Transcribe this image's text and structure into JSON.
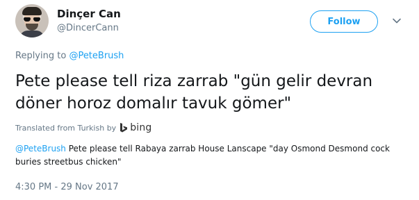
{
  "author": {
    "name": "Dinçer Can",
    "handle": "@DincerCann"
  },
  "actions": {
    "follow_label": "Follow"
  },
  "reply": {
    "prefix": "Replying to ",
    "target": "@PeteBrush"
  },
  "tweet": {
    "text": "Pete please tell riza zarrab \"gün gelir devran döner horoz domalır tavuk gömer\""
  },
  "translation": {
    "source_label": "Translated from Turkish by",
    "provider": "bing",
    "mention": "@PeteBrush",
    "text": " Pete please tell Rabaya zarrab House Lanscape \"day Osmond Desmond cock buries streetbus chicken\""
  },
  "timestamp": "4:30 PM - 29 Nov 2017",
  "colors": {
    "accent": "#1da1f2",
    "secondary_text": "#657786",
    "primary_text": "#14171a"
  }
}
